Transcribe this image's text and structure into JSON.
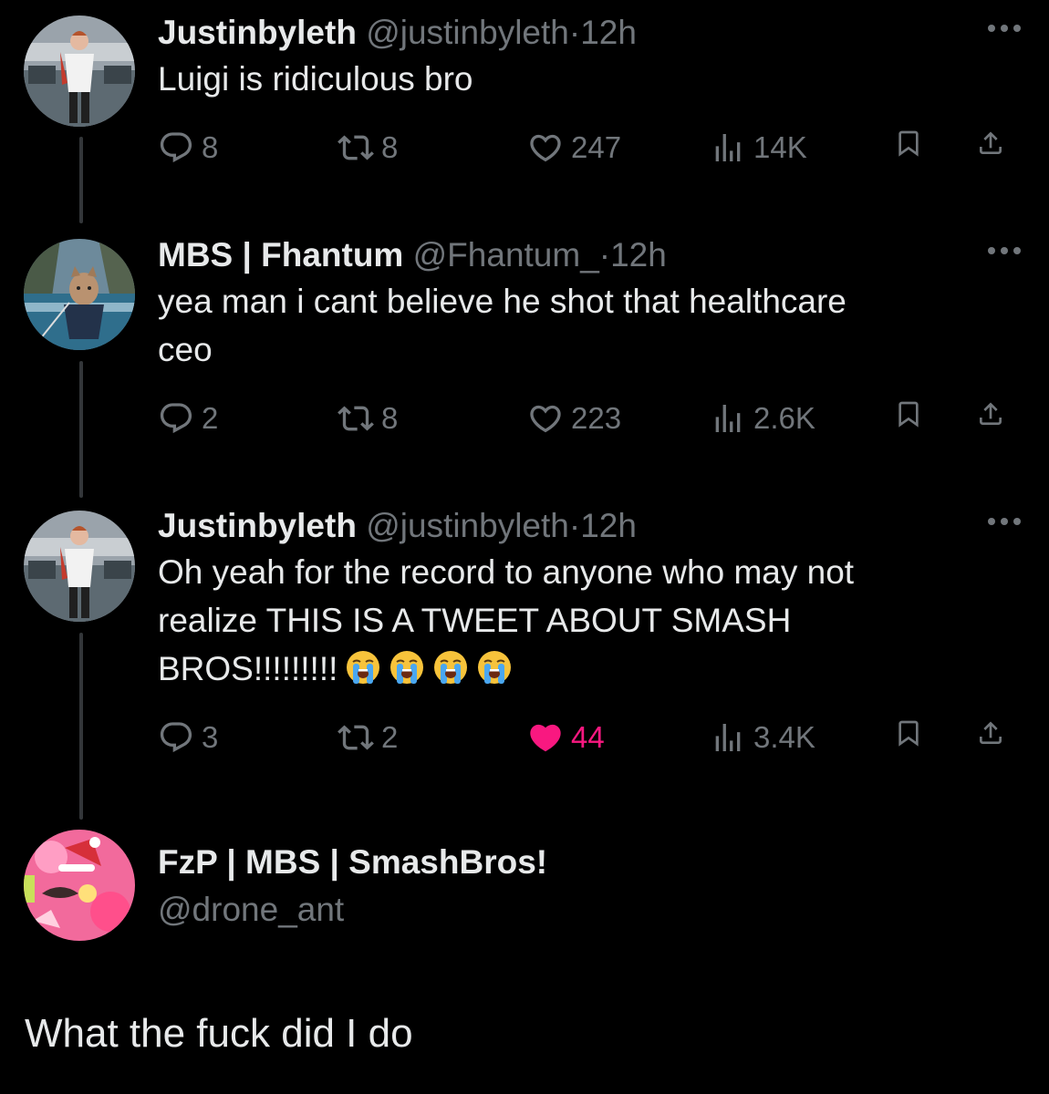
{
  "tweets": [
    {
      "name": "Justinbyleth",
      "handle": "@justinbyleth",
      "separator": "·",
      "time": "12h",
      "text": "Luigi is ridiculous bro",
      "replies": "8",
      "reposts": "8",
      "likes": "247",
      "views": "14K",
      "liked": false
    },
    {
      "name": "MBS | Fhantum",
      "handle": "@Fhantum_",
      "separator": "·",
      "time": "12h",
      "text_line1": "yea man i cant believe he shot that healthcare",
      "text_line2": "ceo",
      "replies": "2",
      "reposts": "8",
      "likes": "223",
      "views": "2.6K",
      "liked": false
    },
    {
      "name": "Justinbyleth",
      "handle": "@justinbyleth",
      "separator": "·",
      "time": "12h",
      "text_line1": "Oh yeah for the record to anyone who may not",
      "text_line2": "realize THIS IS A TWEET ABOUT SMASH",
      "text_line3": "BROS!!!!!!!!!",
      "emojis": [
        "loudly-crying-face",
        "loudly-crying-face",
        "loudly-crying-face",
        "loudly-crying-face"
      ],
      "replies": "3",
      "reposts": "2",
      "likes": "44",
      "views": "3.4K",
      "liked": true
    }
  ],
  "main_tweet": {
    "name": "FzP | MBS | SmashBros!",
    "handle": "@drone_ant",
    "text": "What the fuck did I do"
  },
  "icons": {
    "reply": "reply-icon",
    "repost": "repost-icon",
    "like": "heart-icon",
    "views": "views-icon",
    "bookmark": "bookmark-icon",
    "share": "share-icon",
    "more": "more-icon"
  },
  "colors": {
    "background": "#000000",
    "text": "#e7e9ea",
    "muted": "#71767b",
    "like_active": "#f91880",
    "thread_line": "#333639"
  }
}
